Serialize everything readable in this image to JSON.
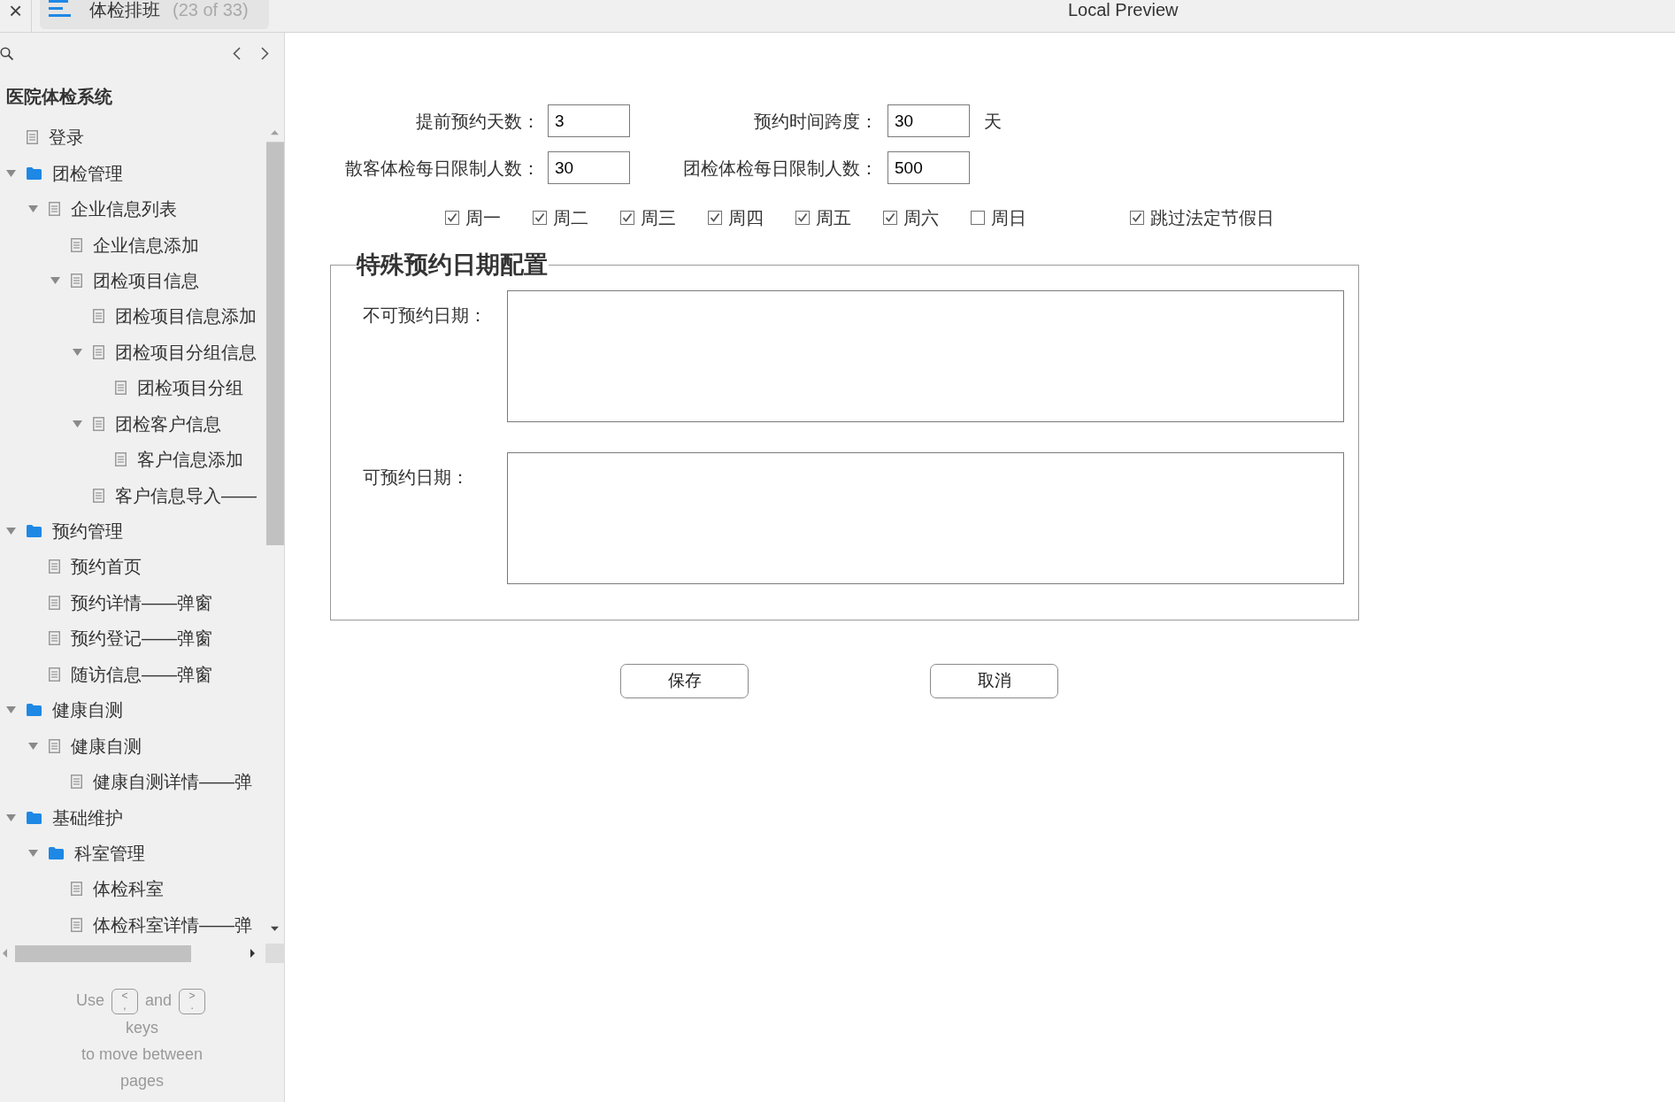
{
  "topbar": {
    "close": "×",
    "page_title": "体检排班",
    "page_count": "(23 of 33)",
    "window_title": "Local Preview"
  },
  "sidebar": {
    "project_title": "医院体检系统",
    "tree": [
      {
        "label": "登录",
        "kind": "page"
      },
      {
        "label": "团检管理",
        "kind": "folder",
        "expanded": true,
        "children": [
          {
            "label": "企业信息列表",
            "kind": "page",
            "expanded": true,
            "children": [
              {
                "label": "企业信息添加",
                "kind": "page"
              },
              {
                "label": "团检项目信息",
                "kind": "page",
                "expanded": true,
                "children": [
                  {
                    "label": "团检项目信息添加",
                    "kind": "page"
                  },
                  {
                    "label": "团检项目分组信息",
                    "kind": "page",
                    "expanded": true,
                    "children": [
                      {
                        "label": "团检项目分组",
                        "kind": "page"
                      }
                    ]
                  },
                  {
                    "label": "团检客户信息",
                    "kind": "page",
                    "expanded": true,
                    "children": [
                      {
                        "label": "客户信息添加",
                        "kind": "page"
                      }
                    ]
                  },
                  {
                    "label": "客户信息导入——",
                    "kind": "page"
                  }
                ]
              }
            ]
          }
        ]
      },
      {
        "label": "预约管理",
        "kind": "folder",
        "expanded": true,
        "children": [
          {
            "label": "预约首页",
            "kind": "page"
          },
          {
            "label": "预约详情——弹窗",
            "kind": "page"
          },
          {
            "label": "预约登记——弹窗",
            "kind": "page"
          },
          {
            "label": "随访信息——弹窗",
            "kind": "page"
          }
        ]
      },
      {
        "label": "健康自测",
        "kind": "folder",
        "expanded": true,
        "children": [
          {
            "label": "健康自测",
            "kind": "page",
            "expanded": true,
            "children": [
              {
                "label": "健康自测详情——弹",
                "kind": "page"
              }
            ]
          }
        ]
      },
      {
        "label": "基础维护",
        "kind": "folder",
        "expanded": true,
        "children": [
          {
            "label": "科室管理",
            "kind": "folder",
            "expanded": true,
            "children": [
              {
                "label": "体检科室",
                "kind": "page"
              },
              {
                "label": "体检科室详情——弹",
                "kind": "page"
              }
            ]
          }
        ]
      }
    ],
    "hint": {
      "before": "Use",
      "keys": [
        {
          "top": "<",
          "bottom": ","
        },
        {
          "top": ">",
          "bottom": "."
        }
      ],
      "between": "and",
      "after": "keys",
      "last": "to move between pages"
    }
  },
  "form": {
    "rows": [
      [
        {
          "label": "提前预约天数：",
          "value": "3"
        },
        {
          "label": "预约时间跨度：",
          "value": "30",
          "suffix": "天"
        }
      ],
      [
        {
          "label": "散客体检每日限制人数：",
          "value": "30"
        },
        {
          "label": "团检体检每日限制人数：",
          "value": "500"
        }
      ]
    ],
    "weekdays": [
      {
        "label": "周一",
        "checked": true
      },
      {
        "label": "周二",
        "checked": true
      },
      {
        "label": "周三",
        "checked": true
      },
      {
        "label": "周四",
        "checked": true
      },
      {
        "label": "周五",
        "checked": true
      },
      {
        "label": "周六",
        "checked": true
      },
      {
        "label": "周日",
        "checked": false
      }
    ],
    "skip_holidays": {
      "label": "跳过法定节假日",
      "checked": true
    },
    "special_dates": {
      "legend": "特殊预约日期配置",
      "fields": [
        {
          "label": "不可预约日期："
        },
        {
          "label": "可预约日期："
        }
      ]
    },
    "buttons": [
      "保存",
      "取消"
    ]
  }
}
